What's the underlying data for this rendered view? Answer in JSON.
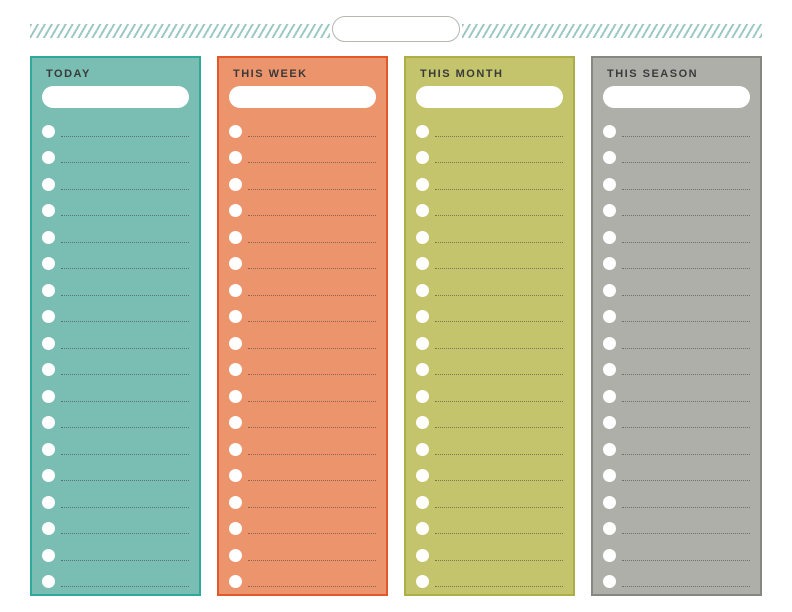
{
  "header": {
    "title": ""
  },
  "columns": [
    {
      "key": "today",
      "label": "TODAY",
      "cssClass": "col-today",
      "rowCount": 18
    },
    {
      "key": "week",
      "label": "THIS WEEK",
      "cssClass": "col-week",
      "rowCount": 18
    },
    {
      "key": "month",
      "label": "THIS MONTH",
      "cssClass": "col-month",
      "rowCount": 18
    },
    {
      "key": "season",
      "label": "THIS SEASON",
      "cssClass": "col-season",
      "rowCount": 18
    }
  ]
}
